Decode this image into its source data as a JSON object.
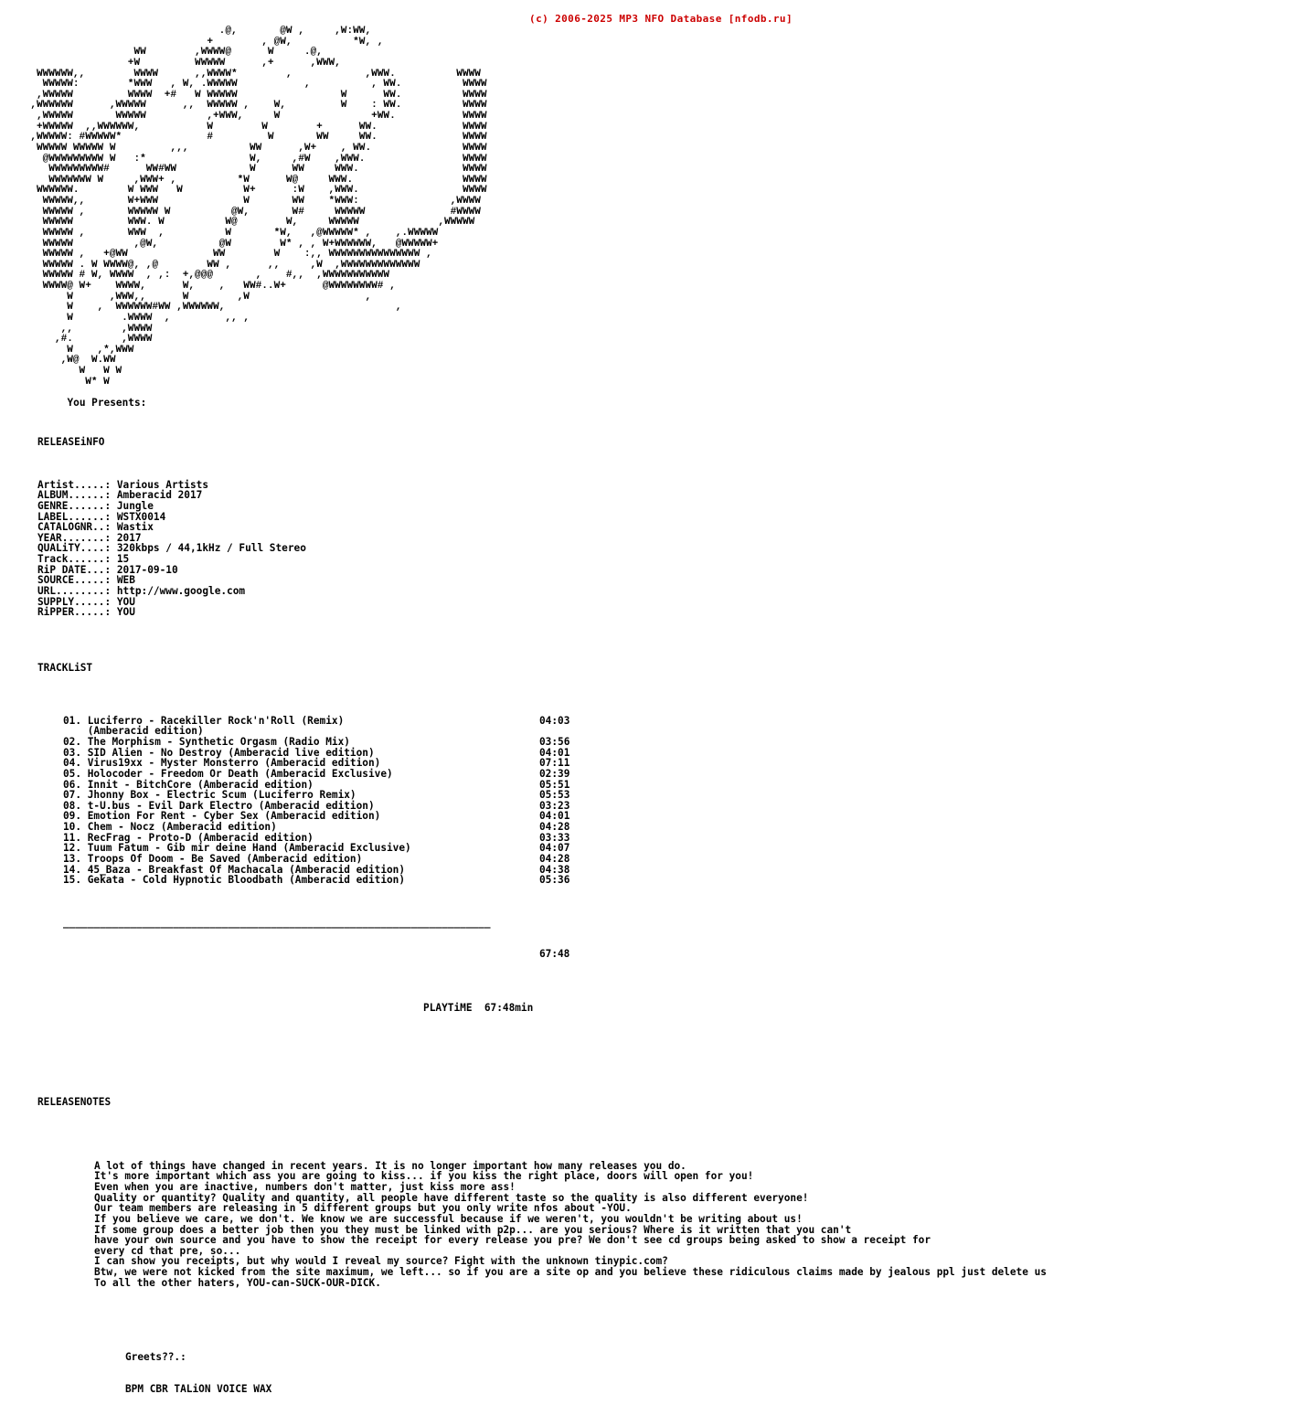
{
  "header": {
    "copyright": "(c) 2006-2025 MP3 NFO Database [nfodb.ru]",
    "color": "#cc0000"
  },
  "ascii_art": {
    "description": "large stylized ASCII-art logo rendered with W, @, #, *, +, comma, colon and period glyphs",
    "lines": [
      "                                    .@,       @W ,     ,W:WW,",
      "                                  +        , @W,          *W, ,",
      "                      WW        ,WWWW@      W     .@,",
      "                     +W         WWWWW      ,+      ,WWW,",
      "      WWWWWW,,        WWWW      ,,WWWW*        ,            ,WWW.          WWWW",
      "       WWWWW:        *WWW   , W, .WWWWW           ,          , WW.          WWWW",
      "      ,WWWWW         WWWW  +#   W WWWWW                 W      WW.          WWWW",
      "     ,WWWWWW      ,WWWWW      ,,  WWWWW ,    W,         W    : WW.          WWWW",
      "      ,WWWWW       WWWWW          ,+WWW,     W               +WW.           WWWW",
      "      +WWWWW  ,,WWWWWW,           W        W        +      WW.              WWWW",
      "     ,WWWWW: #WWWWW*              #         W       WW     WW.              WWWW",
      "      WWWWW WWWWW W         ,,,          WW      ,W+    , WW.               WWWW",
      "       @WWWWWWWWW W   :*                 W,     ,#W    ,WWW.                WWWW",
      "        WWWWWWWWW#      WW#WW            W      WW     WWW.                 WWWW",
      "        WWWWWWW W     ,WWW+ ,          *W      W@     WWW.                  WWWW",
      "      WWWWWW.        W WWW   W          W+      :W    ,WWW.                 WWWW",
      "       WWWWW,,       W+WWW              W       WW    *WWW:               ,WWWW",
      "       WWWWW ,       WWWWW W          @W,       W#     WWWWW              #WWWW",
      "       WWWWW         WWW. W          W@        W,     WWWWW             ,WWWWW",
      "       WWWWW ,       WWW  ,          W       *W,   ,@WWWWW* ,    ,.WWWWW",
      "       WWWWW          ,@W,          @W        W* , , W+WWWWWW,   @WWWWW+",
      "       WWWWW ,   +@WW              WW        W    :,, WWWWWWWWWWWWWWW ,",
      "       WWWWW . W WWWW@, ,@        WW ,      ,,     ,W  ,WWWWWWWWWWWWW",
      "       WWWWW # W, WWWW  , ,:  +,@@@       ,    #,,  ,WWWWWWWWWWW",
      "       WWWW@ W+    WWWW,      W,    ,   WW#..W+      @WWWWWWWW# ,",
      "           W      ,WWW,,      W        ,W                   ,",
      "           W    ,  WWWWWW#WW ,WWWWWW,                            ,",
      "           W        .WWWW  ,         ,, ,",
      "          ,,        ,WWWW",
      "         ,#.        ,WWWW",
      "           W    ,*,WWW",
      "          ,W@  W.WW",
      "             W   W W",
      "              W* W"
    ],
    "presents_line": "           You Presents:"
  },
  "releaseinfo": {
    "heading": "RELEASEiNFO",
    "rows": [
      {
        "label": "Artist.....:",
        "value": "Various Artists"
      },
      {
        "label": "ALBUM......:",
        "value": "Amberacid 2017"
      },
      {
        "label": "GENRE......:",
        "value": "Jungle"
      },
      {
        "label": "LABEL......:",
        "value": "WSTX0014"
      },
      {
        "label": "CATALOGNR..:",
        "value": "Wastix"
      },
      {
        "label": "YEAR.......:",
        "value": "2017"
      },
      {
        "label": "QUALiTY....:",
        "value": "320kbps / 44,1kHz / Full Stereo"
      },
      {
        "label": "Track......:",
        "value": "15"
      },
      {
        "label": "RiP DATE...:",
        "value": "2017-09-10"
      },
      {
        "label": "SOURCE.....:",
        "value": "WEB"
      },
      {
        "label": "URL........:",
        "value": "http://www.google.com"
      },
      {
        "label": "SUPPLY.....:",
        "value": "YOU"
      },
      {
        "label": "RiPPER.....:",
        "value": "YOU"
      }
    ]
  },
  "tracklist": {
    "heading": "TRACKLiST",
    "tracks": [
      {
        "num": "01.",
        "title": "Luciferro - Racekiller Rock'n'Roll (Remix)",
        "cont": "(Amberacid edition)",
        "time": "04:03"
      },
      {
        "num": "02.",
        "title": "The Morphism - Synthetic Orgasm (Radio Mix)",
        "cont": "",
        "time": "03:56"
      },
      {
        "num": "03.",
        "title": "SID Alien - No Destroy (Amberacid live edition)",
        "cont": "",
        "time": "04:01"
      },
      {
        "num": "04.",
        "title": "Virus19xx - Myster Monsterro (Amberacid edition)",
        "cont": "",
        "time": "07:11"
      },
      {
        "num": "05.",
        "title": "Holocoder - Freedom Or Death (Amberacid Exclusive)",
        "cont": "",
        "time": "02:39"
      },
      {
        "num": "06.",
        "title": "Innit - BitchCore (Amberacid edition)",
        "cont": "",
        "time": "05:51"
      },
      {
        "num": "07.",
        "title": "Jhonny Box - Electric Scum (Luciferro Remix)",
        "cont": "",
        "time": "05:53"
      },
      {
        "num": "08.",
        "title": "t-U.bus - Evil Dark Electro (Amberacid edition)",
        "cont": "",
        "time": "03:23"
      },
      {
        "num": "09.",
        "title": "Emotion For Rent - Cyber Sex (Amberacid edition)",
        "cont": "",
        "time": "04:01"
      },
      {
        "num": "10.",
        "title": "Chem - Nocz (Amberacid edition)",
        "cont": "",
        "time": "04:28"
      },
      {
        "num": "11.",
        "title": "RecFrag - Proto-D (Amberacid edition)",
        "cont": "",
        "time": "03:33"
      },
      {
        "num": "12.",
        "title": "Tuum Fatum - Gib mir deine Hand (Amberacid Exclusive)",
        "cont": "",
        "time": "04:07"
      },
      {
        "num": "13.",
        "title": "Troops Of Doom - Be Saved (Amberacid edition)",
        "cont": "",
        "time": "04:28"
      },
      {
        "num": "14.",
        "title": "45_Baza - Breakfast Of Machacala (Amberacid edition)",
        "cont": "",
        "time": "04:38"
      },
      {
        "num": "15.",
        "title": "Gekata - Cold Hypnotic Bloodbath (Amberacid edition)",
        "cont": "",
        "time": "05:36"
      }
    ],
    "divider": "______________________________________________________________________",
    "total_time": "67:48",
    "playtime_label": "PLAYTiME",
    "playtime_value": "67:48min"
  },
  "releasenotes": {
    "heading": "RELEASENOTES",
    "lines": [
      "A lot of things have changed in recent years. It is no longer important how many releases you do.",
      "It's more important which ass you are going to kiss... if you kiss the right place, doors will open for you!",
      "Even when you are inactive, numbers don't matter, just kiss more ass!",
      "Quality or quantity? Quality and quantity, all people have different taste so the quality is also different everyone!",
      "Our team members are releasing in 5 different groups but you only write nfos about -YOU.",
      "If you believe we care, we don't. We know we are successful because if we weren't, you wouldn't be writing about us!",
      "If some group does a better job then you they must be linked with p2p... are you serious? Where is it written that you can't",
      "have your own source and you have to show the receipt for every release you pre? We don't see cd groups being asked to show a receipt for",
      "every cd that pre, so...",
      "I can show you receipts, but why would I reveal my source? Fight with the unknown tinypic.com?",
      "Btw, we were not kicked from the site maximum, we left... so if you are a site op and you believe these ridiculous claims made by jealous ppl just delete us",
      "To all the other haters, YOU-can-SUCK-OUR-DICK."
    ],
    "greets_label": "Greets??.:",
    "greets_list": "BPM CBR TALiON VOICE WAX"
  }
}
